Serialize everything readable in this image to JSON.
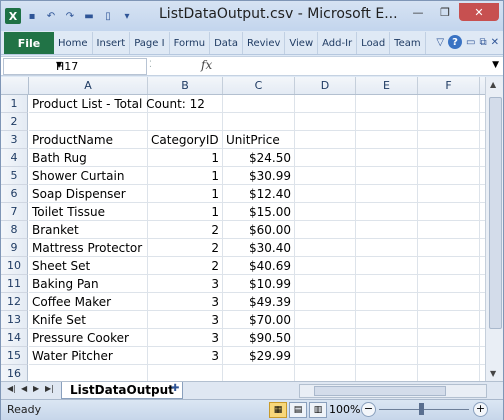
{
  "window": {
    "title": "ListDataOutput.csv - Microsoft E...",
    "minimize_icon": "minimize-icon",
    "maximize_icon": "restore-icon",
    "close_icon": "close-icon"
  },
  "ribbon": {
    "file_label": "File",
    "tabs": [
      "Home",
      "Insert",
      "Page I",
      "Formu",
      "Data",
      "Reviev",
      "View",
      "Add-Ir",
      "Load",
      "Team"
    ]
  },
  "formula_bar": {
    "name_box": "H17",
    "fx_label": "fx",
    "value": ""
  },
  "columns": [
    "A",
    "B",
    "C",
    "D",
    "E",
    "F"
  ],
  "rows": [
    "1",
    "2",
    "3",
    "4",
    "5",
    "6",
    "7",
    "8",
    "9",
    "10",
    "11",
    "12",
    "13",
    "14",
    "15",
    "16"
  ],
  "sheet": {
    "title_cell": "Product List - Total Count: 12",
    "headers": [
      "ProductName",
      "CategoryID",
      "UnitPrice"
    ],
    "products": [
      {
        "name": "Bath Rug",
        "category": "1",
        "price": "$24.50"
      },
      {
        "name": "Shower Curtain",
        "category": "1",
        "price": "$30.99"
      },
      {
        "name": "Soap Dispenser",
        "category": "1",
        "price": "$12.40"
      },
      {
        "name": "Toilet Tissue",
        "category": "1",
        "price": "$15.00"
      },
      {
        "name": "Branket",
        "category": "2",
        "price": "$60.00"
      },
      {
        "name": "Mattress Protector",
        "category": "2",
        "price": "$30.40"
      },
      {
        "name": "Sheet Set",
        "category": "2",
        "price": "$40.69"
      },
      {
        "name": "Baking Pan",
        "category": "3",
        "price": "$10.99"
      },
      {
        "name": "Coffee Maker",
        "category": "3",
        "price": "$49.39"
      },
      {
        "name": "Knife Set",
        "category": "3",
        "price": "$70.00"
      },
      {
        "name": "Pressure Cooker",
        "category": "3",
        "price": "$90.50"
      },
      {
        "name": "Water Pitcher",
        "category": "3",
        "price": "$29.99"
      }
    ]
  },
  "sheet_tabs": [
    "ListDataOutput"
  ],
  "status": {
    "ready": "Ready",
    "zoom": "100%",
    "minus": "−",
    "plus": "+"
  },
  "colors": {
    "file_tab": "#217346",
    "close_button": "#c75050"
  }
}
